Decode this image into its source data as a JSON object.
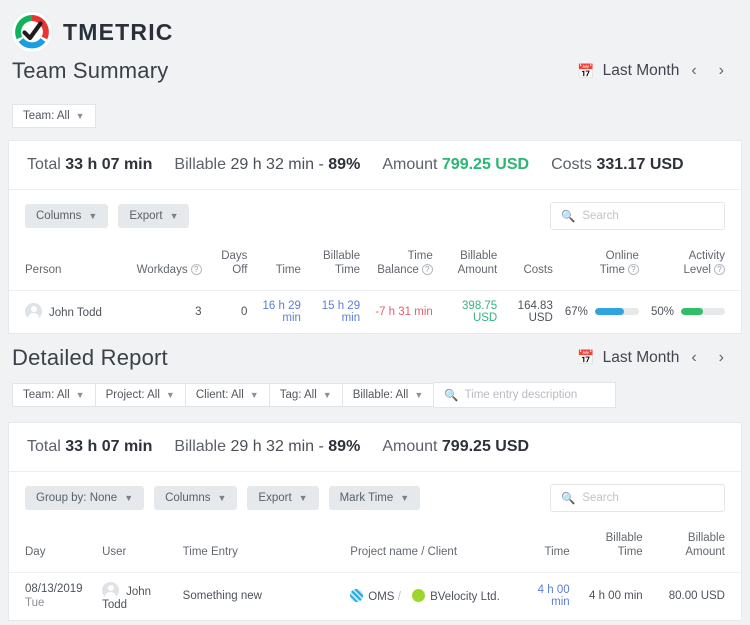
{
  "brand": {
    "name": "TMETRIC",
    "logo_icon": "tmetric-gauge-check-logo"
  },
  "team_summary": {
    "title": "Team Summary",
    "daterange": {
      "icon": "calendar-icon",
      "label": "Last Month",
      "prev": "‹",
      "next": "›"
    },
    "team_filter": "Team: All",
    "totals": {
      "total_label": "Total",
      "total_value": "33 h 07 min",
      "billable_label": "Billable",
      "billable_value": "29 h 32 min - ",
      "billable_pct": "89%",
      "amount_label": "Amount",
      "amount_value": "799.25 USD",
      "costs_label": "Costs",
      "costs_value": "331.17 USD",
      "amount_color": "#2bb673"
    },
    "toolbar": {
      "columns": "Columns",
      "export": "Export",
      "search_placeholder": "Search"
    },
    "columns": [
      {
        "l1": "Person",
        "l2": "",
        "help": false
      },
      {
        "l1": "Workdays",
        "l2": "",
        "help": true
      },
      {
        "l1": "Days",
        "l2": "Off",
        "help": false
      },
      {
        "l1": "Time",
        "l2": "",
        "help": false
      },
      {
        "l1": "Billable",
        "l2": "Time",
        "help": false
      },
      {
        "l1": "Time",
        "l2": "Balance",
        "help": true
      },
      {
        "l1": "Billable",
        "l2": "Amount",
        "help": false
      },
      {
        "l1": "Costs",
        "l2": "",
        "help": false
      },
      {
        "l1": "Online",
        "l2": "Time",
        "help": true
      },
      {
        "l1": "Activity",
        "l2": "Level",
        "help": true
      }
    ],
    "rows": [
      {
        "person": "John Todd",
        "workdays": "3",
        "days_off": "0",
        "time": "16 h 29 min",
        "billable_time": "15 h 29 min",
        "time_balance": "-7 h 31 min",
        "billable_amount": "398.75 USD",
        "costs": "164.83 USD",
        "online_time_pct": "67%",
        "online_time_value": 67,
        "online_time_color": "#30a3e0",
        "activity_pct": "50%",
        "activity_value": 50,
        "activity_color": "#30bf68"
      }
    ]
  },
  "detailed_report": {
    "title": "Detailed Report",
    "daterange": {
      "icon": "calendar-icon",
      "label": "Last Month",
      "prev": "‹",
      "next": "›"
    },
    "filters": [
      {
        "label": "Team: All"
      },
      {
        "label": "Project: All"
      },
      {
        "label": "Client: All"
      },
      {
        "label": "Tag: All"
      },
      {
        "label": "Billable: All"
      }
    ],
    "search_placeholder": "Time entry description",
    "totals": {
      "total_label": "Total",
      "total_value": "33 h 07 min",
      "billable_label": "Billable",
      "billable_value": "29 h 32 min - ",
      "billable_pct": "89%",
      "amount_label": "Amount",
      "amount_value": "799.25 USD"
    },
    "toolbar": {
      "group_by": "Group by: None",
      "columns": "Columns",
      "export": "Export",
      "mark_time": "Mark Time",
      "search_placeholder": "Search"
    },
    "columns": [
      {
        "label": "Day"
      },
      {
        "label": "User"
      },
      {
        "label": "Time Entry"
      },
      {
        "label": "Project name / Client"
      },
      {
        "label": "Time"
      },
      {
        "label": "Billable Time"
      },
      {
        "label": "Billable Amount"
      }
    ],
    "rows": [
      {
        "date": "08/13/2019",
        "dow": "Tue",
        "user": "John Todd",
        "entry": "Something new",
        "project": "OMS",
        "separator": "/",
        "client": "BVelocity Ltd.",
        "time": "4 h 00 min",
        "billable_time": "4 h 00 min",
        "billable_amount": "80.00 USD",
        "project_color": "#29a9e0",
        "client_color": "#9bd62c"
      }
    ]
  }
}
